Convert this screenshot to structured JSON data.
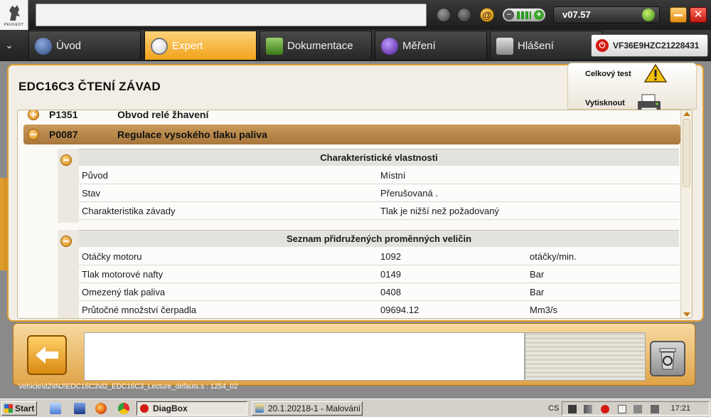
{
  "app": {
    "brand": "PEUGEOT",
    "version": "v07.57",
    "vin": "VF36E9HZC21228431"
  },
  "nav": {
    "tabs": [
      {
        "label": "Úvod",
        "icon": "home-globe-icon"
      },
      {
        "label": "Expert",
        "icon": "magnifier-icon",
        "active": true
      },
      {
        "label": "Dokumentace",
        "icon": "book-icon"
      },
      {
        "label": "Měření",
        "icon": "waveform-icon"
      },
      {
        "label": "Hlášení",
        "icon": "report-icon"
      }
    ]
  },
  "page": {
    "title": "EDC16C3  ČTENÍ ZÁVAD",
    "actions": {
      "overall_test": "Celkový test",
      "print": "Vytisknout"
    }
  },
  "faults": [
    {
      "code": "P1351",
      "description": "Obvod relé žhavení",
      "expanded": false
    },
    {
      "code": "P0087",
      "description": "Regulace vysokého tlaku paliva",
      "expanded": true
    }
  ],
  "characteristics": {
    "title": "Charakteristické vlastnosti",
    "rows": [
      {
        "key": "Původ",
        "value": "Místní"
      },
      {
        "key": "Stav",
        "value": "Přerušovaná ."
      },
      {
        "key": "Charakteristika závady",
        "value": "Tlak je nižší než požadovaný"
      }
    ]
  },
  "variables": {
    "title": "Seznam přidružených proměnných veličin",
    "rows": [
      {
        "key": "Otáčky motoru",
        "value": "1092",
        "unit": "otáčky/min."
      },
      {
        "key": "Tlak motorové nafty",
        "value": "0149",
        "unit": "Bar"
      },
      {
        "key": "Omezený tlak paliva",
        "value": "0408",
        "unit": "Bar"
      },
      {
        "key": "Průtočné množství čerpadla",
        "value": "09694.12",
        "unit": "Mm3/s"
      }
    ]
  },
  "status_path": "Vehicle\\d2\\INJ\\EDC16C3\\d2_EDC16C3_Lecture_defauts.s : 1254_02",
  "taskbar": {
    "start": "Start",
    "tasks": [
      {
        "label": "DiagBox",
        "active": true
      },
      {
        "label": "20.1.20218-1 - Malování",
        "active": false
      }
    ],
    "language": "CS",
    "clock": "17:21"
  },
  "colors": {
    "accent": "#f0a21a",
    "panel_border": "#e0a030",
    "fault_row": "#b5854a"
  }
}
